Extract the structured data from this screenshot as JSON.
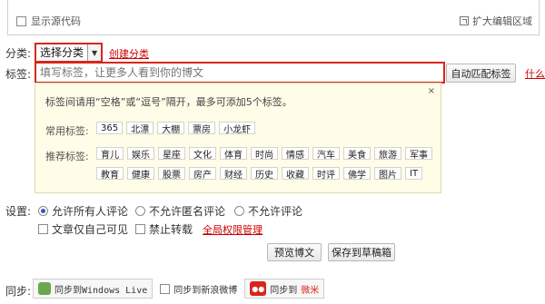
{
  "editor": {
    "show_source_label": "显示源代码",
    "expand_label": "扩大编辑区域"
  },
  "category": {
    "label": "分类:",
    "selected": "选择分类",
    "create_link": "创建分类"
  },
  "tags": {
    "label": "标签:",
    "placeholder": "填写标签，让更多人看到你的博文",
    "auto_match_button": "自动匹配标签",
    "more_link": "什么",
    "close": "×",
    "hint": "标签间请用“空格”或“逗号”隔开，最多可添加5个标签。",
    "common_label": "常用标签:",
    "common": [
      "365",
      "北漂",
      "大棚",
      "票房",
      "小龙虾"
    ],
    "recommended_label": "推荐标签:",
    "recommended_row1": [
      "育儿",
      "娱乐",
      "星座",
      "文化",
      "体育",
      "时尚",
      "情感",
      "汽车",
      "美食",
      "旅游",
      "军事"
    ],
    "recommended_row2": [
      "教育",
      "健康",
      "股票",
      "房产",
      "财经",
      "历史",
      "收藏",
      "时评",
      "佛学",
      "图片",
      "IT"
    ]
  },
  "settings": {
    "label": "设置:",
    "comment_all": "允许所有人评论",
    "comment_anon": "不允许匿名评论",
    "comment_none": "不允许评论",
    "self_only": "文章仅自己可见",
    "no_repost": "禁止转载",
    "permission_link": "全局权限管理"
  },
  "actions": {
    "preview": "预览博文",
    "save_draft": "保存到草稿箱"
  },
  "sync": {
    "label": "同步:",
    "windows_live": "同步到Windows Live",
    "sina_weibo": "同步到新浪微博",
    "weimi_prefix": "同步到",
    "weimi_name": "微米"
  }
}
